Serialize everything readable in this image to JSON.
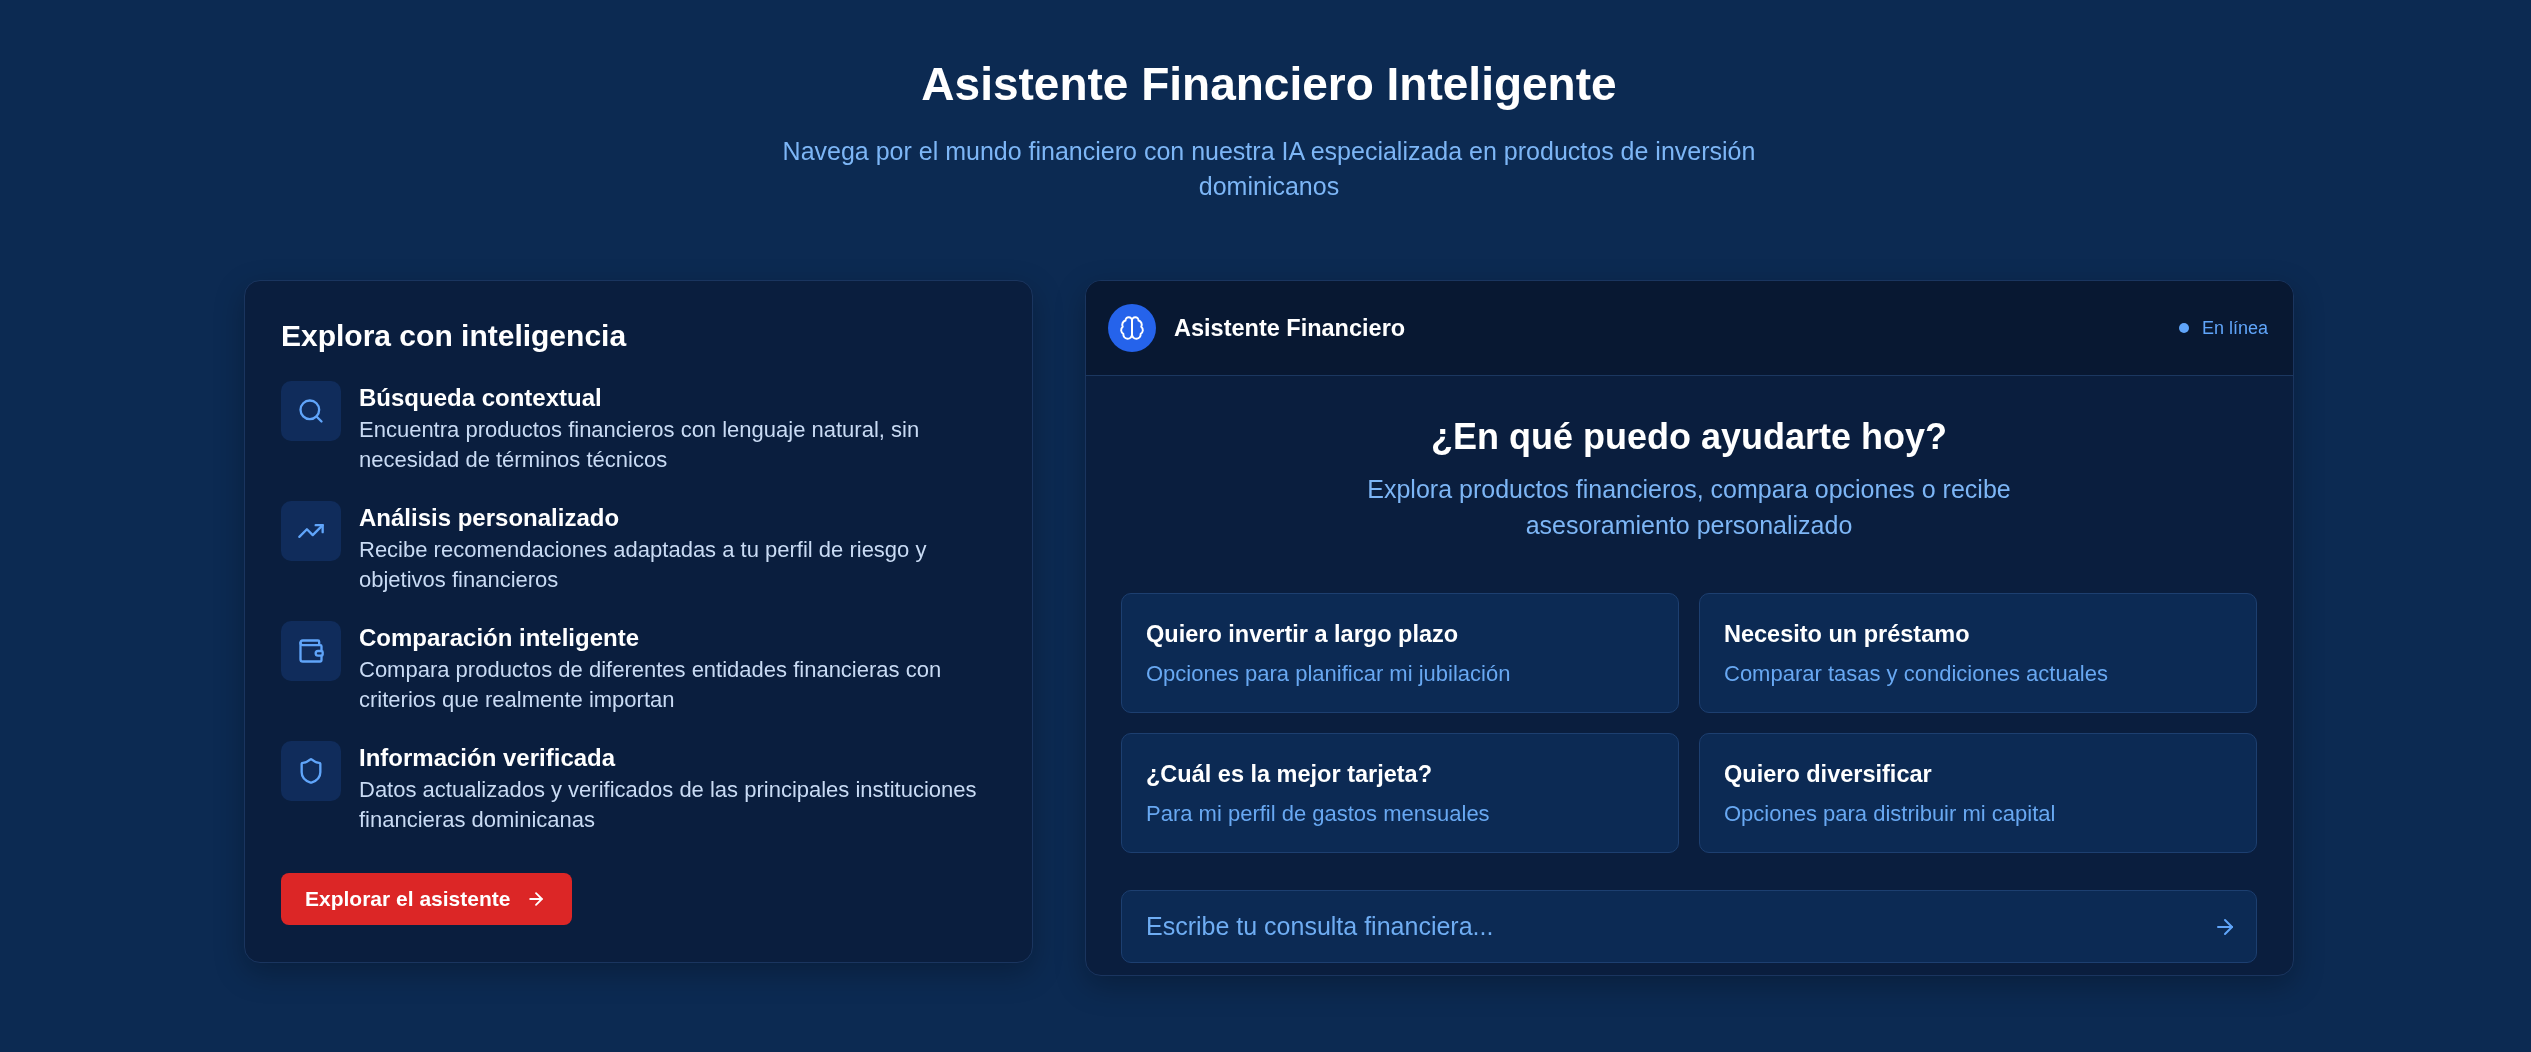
{
  "header": {
    "title": "Asistente Financiero Inteligente",
    "subtitle": "Navega por el mundo financiero con nuestra IA especializada en productos de inversión dominicanos"
  },
  "features_card": {
    "title": "Explora con inteligencia",
    "items": [
      {
        "title": "Búsqueda contextual",
        "description": "Encuentra productos financieros con lenguaje natural, sin necesidad de términos técnicos"
      },
      {
        "title": "Análisis personalizado",
        "description": "Recibe recomendaciones adaptadas a tu perfil de riesgo y objetivos financieros"
      },
      {
        "title": "Comparación inteligente",
        "description": "Compara productos de diferentes entidades financieras con criterios que realmente importan"
      },
      {
        "title": "Información verificada",
        "description": "Datos actualizados y verificados de las principales instituciones financieras dominicanas"
      }
    ],
    "button": {
      "label": "Explorar el asistente"
    }
  },
  "assistant": {
    "name": "Asistente Financiero",
    "status": {
      "label": "En línea",
      "online": true
    },
    "greeting": "¿En qué puedo ayudarte hoy?",
    "intro": "Explora productos financieros, compara opciones o recibe asesoramiento personalizado",
    "suggestions": [
      {
        "title": "Quiero invertir a largo plazo",
        "description": "Opciones para planificar mi jubilación"
      },
      {
        "title": "Necesito un préstamo",
        "description": "Comparar tasas y condiciones actuales"
      },
      {
        "title": "¿Cuál es la mejor tarjeta?",
        "description": "Para mi perfil de gastos mensuales"
      },
      {
        "title": "Quiero diversificar",
        "description": "Opciones para distribuir mi capital"
      }
    ],
    "input": {
      "placeholder": "Escribe tu consulta financiera..."
    }
  }
}
